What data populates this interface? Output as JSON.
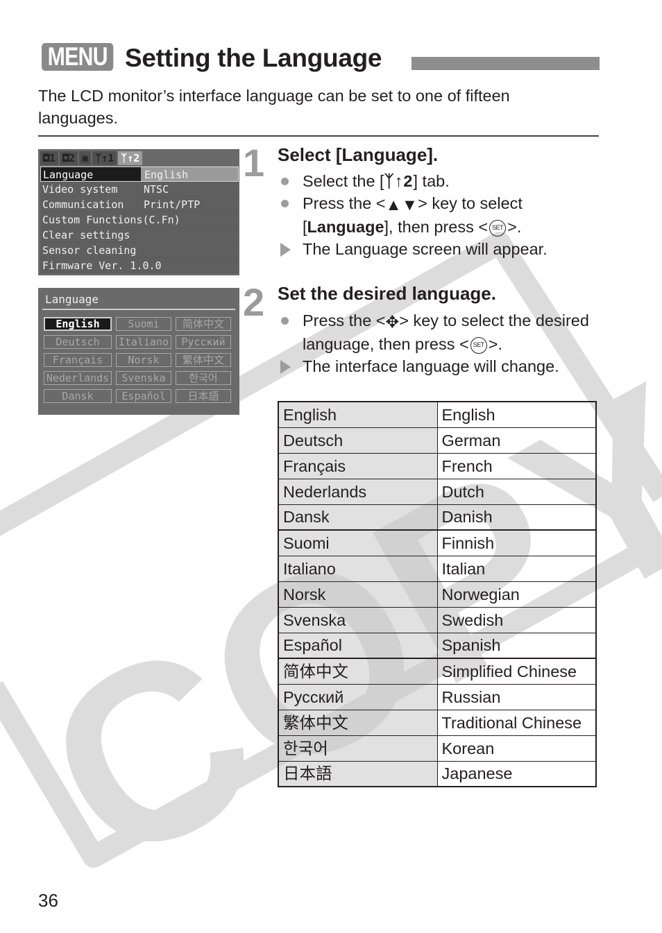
{
  "header": {
    "menu_badge": "MENU",
    "title": "Setting the Language",
    "intro": "The LCD monitor’s interface language can be set to one of fifteen languages."
  },
  "lcd_menu": {
    "tabs": [
      {
        "icon": "camera-icon",
        "label": "1"
      },
      {
        "icon": "camera-icon",
        "label": "2"
      },
      {
        "icon": "playback-icon",
        "label": ""
      },
      {
        "icon": "tools-icon",
        "label": "1"
      },
      {
        "icon": "tools-icon",
        "label": "2",
        "active": true
      }
    ],
    "rows": [
      {
        "key": "Language",
        "value": "English",
        "selected": true
      },
      {
        "key": "Video system",
        "value": "NTSC"
      },
      {
        "key": "Communication",
        "value": "Print/PTP"
      },
      {
        "key": "Custom Functions(C.Fn)",
        "value": ""
      },
      {
        "key": "Clear settings",
        "value": ""
      },
      {
        "key": "Sensor cleaning",
        "value": ""
      },
      {
        "key": "Firmware Ver. 1.0.0",
        "value": ""
      }
    ]
  },
  "lcd_language": {
    "title": "Language",
    "grid": [
      "English",
      "Suomi",
      "简体中文",
      "Deutsch",
      "Italiano",
      "Русский",
      "Français",
      "Norsk",
      "繁体中文",
      "Nederlands",
      "Svenska",
      "한국어",
      "Dansk",
      "Español",
      "日本語"
    ],
    "selected": "English"
  },
  "steps": [
    {
      "number": "1",
      "heading": "Select [Language].",
      "items": [
        {
          "type": "bullet",
          "parts": [
            "Select the [",
            "ᛉ↑2",
            "] tab."
          ]
        },
        {
          "type": "bullet",
          "parts": [
            "Press the <",
            "▲▼",
            "> key to select [",
            "Language",
            "], then press <",
            "SET",
            ">."
          ]
        },
        {
          "type": "result",
          "text": "The Language screen will appear."
        }
      ]
    },
    {
      "number": "2",
      "heading": "Set the desired language.",
      "items": [
        {
          "type": "bullet",
          "parts": [
            "Press the <",
            "✥",
            "> key to select the desired language, then press <",
            "SET",
            ">."
          ]
        },
        {
          "type": "result",
          "text": "The interface language will change."
        }
      ]
    }
  ],
  "language_table": {
    "rows": [
      [
        "English",
        "English"
      ],
      [
        "Deutsch",
        "German"
      ],
      [
        "Français",
        "French"
      ],
      [
        "Nederlands",
        "Dutch"
      ],
      [
        "Dansk",
        "Danish"
      ],
      [
        "Suomi",
        "Finnish"
      ],
      [
        "Italiano",
        "Italian"
      ],
      [
        "Norsk",
        "Norwegian"
      ],
      [
        "Svenska",
        "Swedish"
      ],
      [
        "Español",
        "Spanish"
      ],
      [
        "简体中文",
        "Simplified Chinese"
      ],
      [
        "Русский",
        "Russian"
      ],
      [
        "繁体中文",
        "Traditional Chinese"
      ],
      [
        "한국어",
        "Korean"
      ],
      [
        "日本語",
        "Japanese"
      ]
    ]
  },
  "watermark": "COPY",
  "page_number": "36",
  "colors": {
    "text": "#231f20",
    "accent_gray": "#8e8e8e",
    "lcd_bg": "#6a6a6a",
    "watermark": "#dcdcdc"
  }
}
